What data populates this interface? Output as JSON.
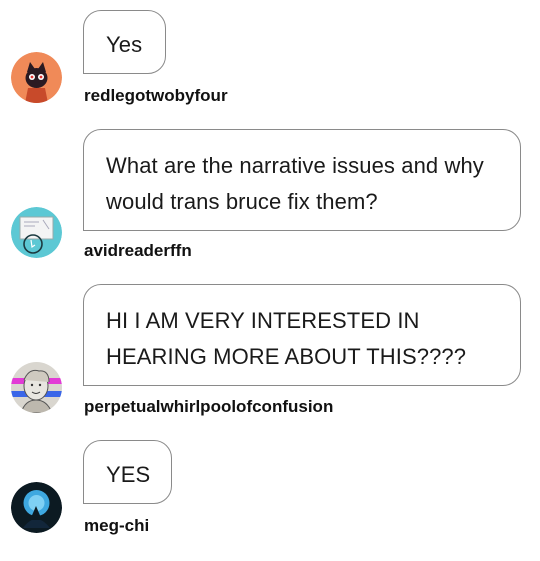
{
  "messages": [
    {
      "text": "Yes",
      "username": "redlegotwobyfour",
      "avatar_icon": "cat-avatar-icon"
    },
    {
      "text": "What are the narrative issues and why would trans bruce fix them?",
      "username": "avidreaderffn",
      "avatar_icon": "whiteboard-avatar-icon"
    },
    {
      "text": "HI I AM VERY INTERESTED IN HEARING MORE ABOUT THIS????",
      "username": "perpetualwhirlpoolofconfusion",
      "avatar_icon": "sketch-portrait-avatar-icon"
    },
    {
      "text": "YES",
      "username": "meg-chi",
      "avatar_icon": "blue-silhouette-avatar-icon"
    }
  ],
  "colors": {
    "bubble_border": "#8a8a8a",
    "text": "#1a1a1a",
    "background": "#ffffff"
  }
}
